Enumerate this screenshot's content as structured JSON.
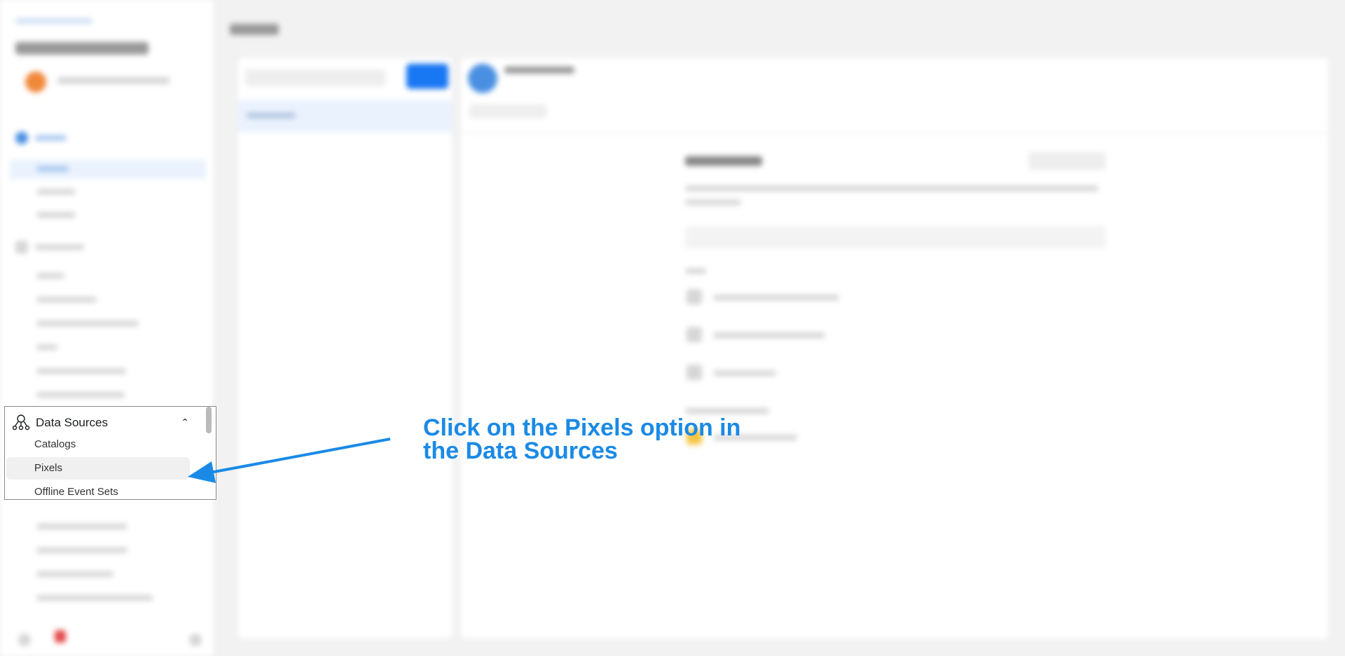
{
  "sidebar": {
    "section": {
      "label": "Data Sources",
      "icon": "data-sources-icon",
      "expanded": true
    },
    "items": [
      {
        "label": "Catalogs",
        "selected": false
      },
      {
        "label": "Pixels",
        "selected": true
      },
      {
        "label": "Offline Event Sets",
        "selected": false
      }
    ]
  },
  "callout": {
    "line1": "Click on the Pixels option in",
    "line2": "the Data Sources",
    "color": "#1a8ae6"
  }
}
